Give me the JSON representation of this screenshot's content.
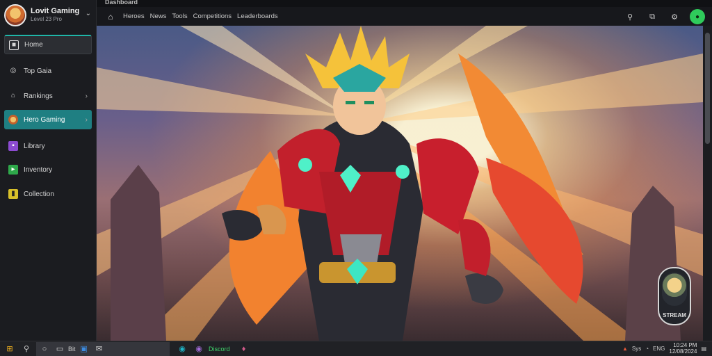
{
  "window": {
    "title": "Dashboard"
  },
  "profile": {
    "name": "Lovit Gaming",
    "subtitle": "Level 23 Pro"
  },
  "sidebar": {
    "items": [
      {
        "label": "Home",
        "icon": "home-icon"
      },
      {
        "label": "Top Gaia",
        "icon": "globe-icon"
      },
      {
        "label": "Rankings",
        "icon": "trophy-icon"
      },
      {
        "label": "Hero Gaming",
        "icon": "avatar-icon"
      },
      {
        "label": "Library",
        "icon": "library-icon"
      },
      {
        "label": "Inventory",
        "icon": "inventory-icon"
      },
      {
        "label": "Collection",
        "icon": "collection-icon"
      }
    ]
  },
  "header": {
    "tabs": [
      "Heroes",
      "News",
      "Tools",
      "Competitions",
      "Leaderboards"
    ]
  },
  "mini_player": {
    "label": "STREAM"
  },
  "taskbar": {
    "search_label": "Bit",
    "app_label": "Discord",
    "tray_a": "Sys",
    "tray_b": "ENG",
    "time": "10:24 PM",
    "date": "12/08/2024"
  },
  "colors": {
    "accent_teal": "#1f7f82",
    "online_green": "#2fcb5b",
    "sidebar_bg": "#1b1c20"
  }
}
